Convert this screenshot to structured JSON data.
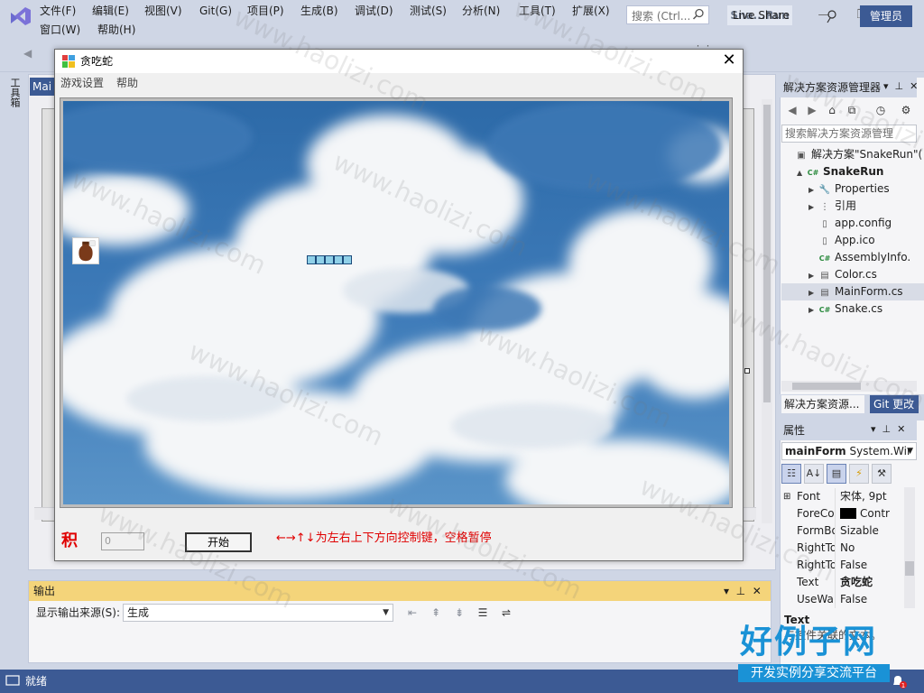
{
  "vs": {
    "menu": [
      "文件(F)",
      "编辑(E)",
      "视图(V)",
      "Git(G)",
      "项目(P)",
      "生成(B)",
      "调试(D)",
      "测试(S)",
      "分析(N)",
      "工具(T)",
      "扩展(X)"
    ],
    "menu_row2": [
      "窗口(W)",
      "帮助(H)"
    ],
    "search_placeholder": "搜索 (Ctrl...",
    "solution_badge": "Sna...Run",
    "live_share": "Live Share",
    "admin": "管理员",
    "toolbox_label": "工具箱",
    "doc_tab": "Mai",
    "status_text": "就绪",
    "notification_count": "1"
  },
  "snake_form": {
    "title": "贪吃蛇",
    "menu": [
      "游戏设置",
      "帮助"
    ],
    "score_label": "积",
    "score_value": "0",
    "start_button": "开始",
    "hint": "←→↑↓为左右上下方向控制键，空格暂停",
    "snake_segments": 5
  },
  "output": {
    "title": "输出",
    "source_label": "显示输出来源(S):",
    "source_value": "生成"
  },
  "solution_explorer": {
    "title": "解决方案资源管理器",
    "search_placeholder": "搜索解决方案资源管理",
    "tree": [
      {
        "label": "解决方案\"SnakeRun\"(",
        "icon": "solution-icon",
        "level": 0,
        "exp": ""
      },
      {
        "label": "SnakeRun",
        "icon": "csharp-project-icon",
        "level": 1,
        "exp": "▲",
        "bold": true
      },
      {
        "label": "Properties",
        "icon": "wrench-icon",
        "level": 2,
        "exp": "▶"
      },
      {
        "label": "引用",
        "icon": "references-icon",
        "level": 2,
        "exp": "▶"
      },
      {
        "label": "app.config",
        "icon": "config-file-icon",
        "level": 2,
        "exp": ""
      },
      {
        "label": "App.ico",
        "icon": "ico-file-icon",
        "level": 2,
        "exp": ""
      },
      {
        "label": "AssemblyInfo.",
        "icon": "csharp-file-icon",
        "level": 2,
        "exp": ""
      },
      {
        "label": "Color.cs",
        "icon": "form-file-icon",
        "level": 2,
        "exp": "▶"
      },
      {
        "label": "MainForm.cs",
        "icon": "form-file-icon",
        "level": 2,
        "exp": "▶",
        "selected": true
      },
      {
        "label": "Snake.cs",
        "icon": "csharp-file-icon",
        "level": 2,
        "exp": "▶"
      }
    ],
    "tab_active": "解决方案资源...",
    "tab_git": "Git 更改"
  },
  "properties": {
    "title": "属性",
    "object_name": "mainForm",
    "object_type": "System.Wir",
    "rows": [
      {
        "name": "Font",
        "value": "宋体, 9pt",
        "expand": true
      },
      {
        "name": "ForeColo",
        "value": "Contr",
        "swatch": "#000000"
      },
      {
        "name": "FormBorc",
        "value": "Sizable"
      },
      {
        "name": "RightToLe",
        "value": "No"
      },
      {
        "name": "RightToLe",
        "value": "False"
      },
      {
        "name": "Text",
        "value": "贪吃蛇",
        "bold": true
      },
      {
        "name": "UseWaitC",
        "value": "False"
      }
    ],
    "desc_title": "Text",
    "desc_text": "与控件关联的文本。"
  },
  "watermark": {
    "text": "www.haolizi.com",
    "logo": "好例子网",
    "logo_sub": "开发实例分享交流平台"
  },
  "colors": {
    "vs_chrome": "#cfd6e5",
    "vs_accent": "#3c5a94",
    "output_header": "#f4d47a",
    "hint_red": "#e00000"
  }
}
